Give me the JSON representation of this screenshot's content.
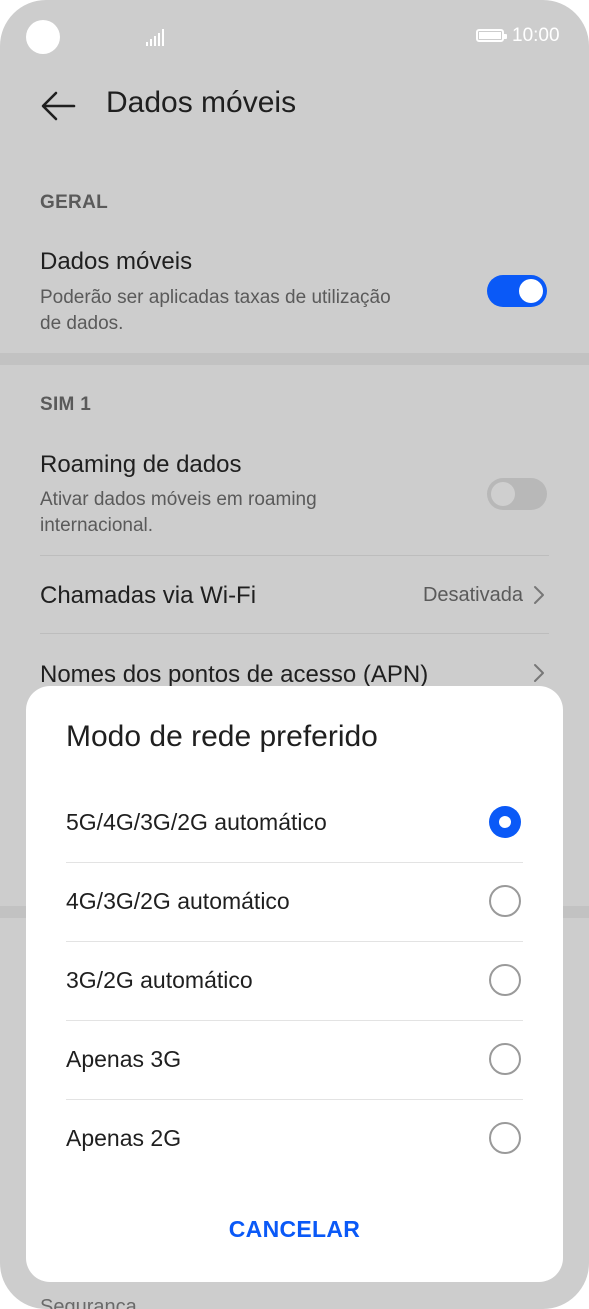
{
  "status_bar": {
    "time": "10:00"
  },
  "header": {
    "title": "Dados móveis"
  },
  "sections": {
    "general": {
      "label": "GERAL",
      "mobile_data": {
        "title": "Dados móveis",
        "subtitle": "Poderão ser aplicadas taxas de utilização de dados.",
        "enabled": true
      }
    },
    "sim1": {
      "label": "SIM 1",
      "roaming": {
        "title": "Roaming de dados",
        "subtitle": "Ativar dados móveis em roaming internacional.",
        "enabled": false
      },
      "wifi_calling": {
        "title": "Chamadas via Wi-Fi",
        "value": "Desativada"
      },
      "apn": {
        "title": "Nomes dos pontos de acesso (APN)"
      }
    }
  },
  "bottom_peek": "Segurança",
  "dialog": {
    "title": "Modo de rede preferido",
    "options": [
      {
        "label": "5G/4G/3G/2G automático",
        "selected": true
      },
      {
        "label": "4G/3G/2G automático",
        "selected": false
      },
      {
        "label": "3G/2G automático",
        "selected": false
      },
      {
        "label": "Apenas 3G",
        "selected": false
      },
      {
        "label": "Apenas 2G",
        "selected": false
      }
    ],
    "cancel_label": "CANCELAR"
  },
  "colors": {
    "accent": "#0a59f7",
    "screen_dim": "#cdcdcd",
    "dialog_bg": "#ffffff"
  },
  "icons": [
    "camera-cutout",
    "signal-icon",
    "battery-icon",
    "back-arrow-icon",
    "chevron-right-icon",
    "radio-icon"
  ]
}
